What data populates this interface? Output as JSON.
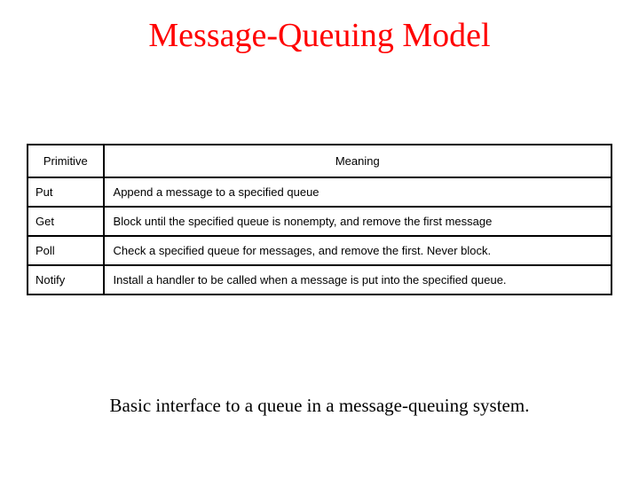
{
  "title": "Message-Queuing Model",
  "table": {
    "headers": {
      "col1": "Primitive",
      "col2": "Meaning"
    },
    "rows": [
      {
        "primitive": "Put",
        "meaning": "Append a message to a specified queue"
      },
      {
        "primitive": "Get",
        "meaning": "Block until the specified queue is nonempty, and remove the first message"
      },
      {
        "primitive": "Poll",
        "meaning": "Check a specified queue for messages, and remove the first. Never block."
      },
      {
        "primitive": "Notify",
        "meaning": "Install a handler to be called when a message is put into the specified queue."
      }
    ]
  },
  "caption": "Basic interface to a queue in a message-queuing system."
}
